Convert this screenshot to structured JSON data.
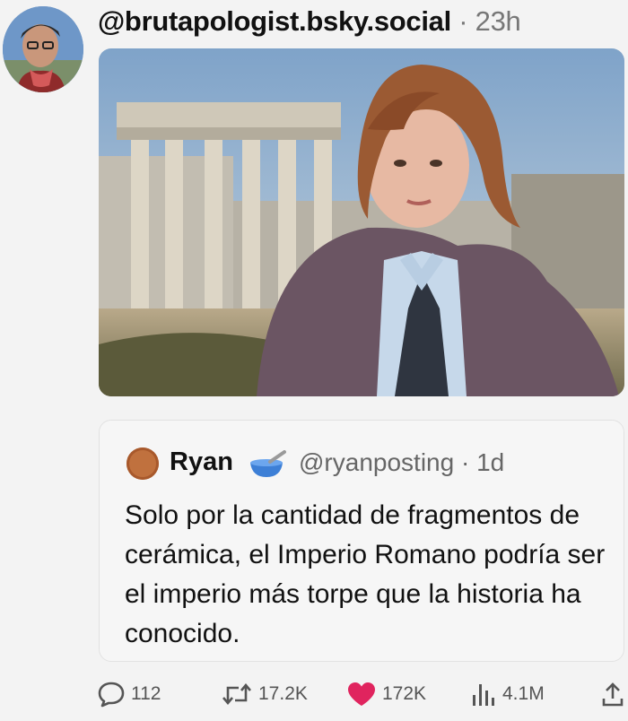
{
  "post": {
    "handle": "@brutapologist.bsky.social",
    "separator": "·",
    "time": "23h"
  },
  "quote": {
    "name": "Ryan",
    "handle": "@ryanposting",
    "separator": "·",
    "time": "1d",
    "text": "Solo por la cantidad de fragmentos de cerámica, el Imperio Romano podría ser el imperio más torpe que la historia ha conocido."
  },
  "actions": {
    "replies": "112",
    "reposts": "17.2K",
    "likes": "172K",
    "views": "4.1M"
  },
  "colors": {
    "like": "#e0245e",
    "muted": "#555555",
    "background": "#f3f3f3"
  },
  "icons": [
    "reply-icon",
    "repost-icon",
    "heart-icon",
    "views-icon",
    "share-icon",
    "bowl-emoji-icon"
  ]
}
